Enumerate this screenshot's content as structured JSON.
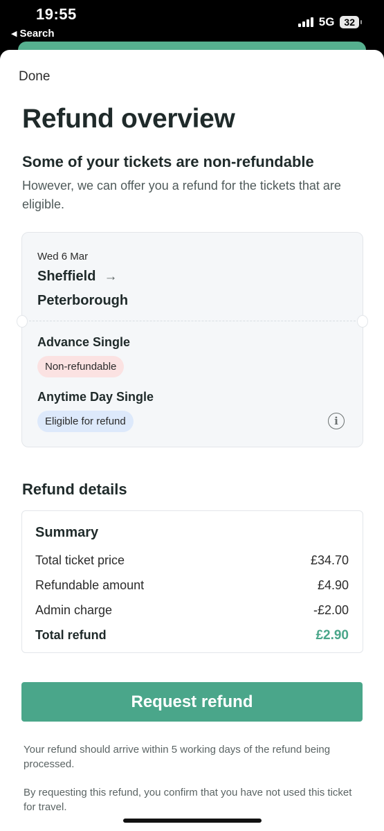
{
  "status_bar": {
    "time": "19:55",
    "back_label": "Search",
    "network": "5G",
    "battery": "32"
  },
  "header": {
    "done_label": "Done",
    "title": "Refund overview",
    "subtitle": "Some of your tickets are non-refundable",
    "description": "However, we can offer you a refund for the tickets that are eligible."
  },
  "journey": {
    "date": "Wed 6 Mar",
    "origin": "Sheffield",
    "destination": "Peterborough",
    "tickets": [
      {
        "name": "Advance Single",
        "status": "Non-refundable",
        "status_color": "#fbe2e2"
      },
      {
        "name": "Anytime Day Single",
        "status": "Eligible for refund",
        "status_color": "#dde9fb"
      }
    ]
  },
  "refund_details": {
    "section_title": "Refund details",
    "summary_title": "Summary",
    "rows": [
      {
        "label": "Total ticket price",
        "value": "£34.70"
      },
      {
        "label": "Refundable amount",
        "value": "£4.90"
      },
      {
        "label": "Admin charge",
        "value": "-£2.00"
      },
      {
        "label": "Total refund",
        "value": "£2.90"
      }
    ]
  },
  "cta": {
    "label": "Request refund"
  },
  "notes": [
    "Your refund should arrive within 5 working days of the refund being processed.",
    "By requesting this refund, you confirm that you have not used this ticket for travel."
  ],
  "colors": {
    "accent": "#4aa68a",
    "non_refundable_badge": "#fbe2e2",
    "eligible_badge": "#dde9fb"
  }
}
